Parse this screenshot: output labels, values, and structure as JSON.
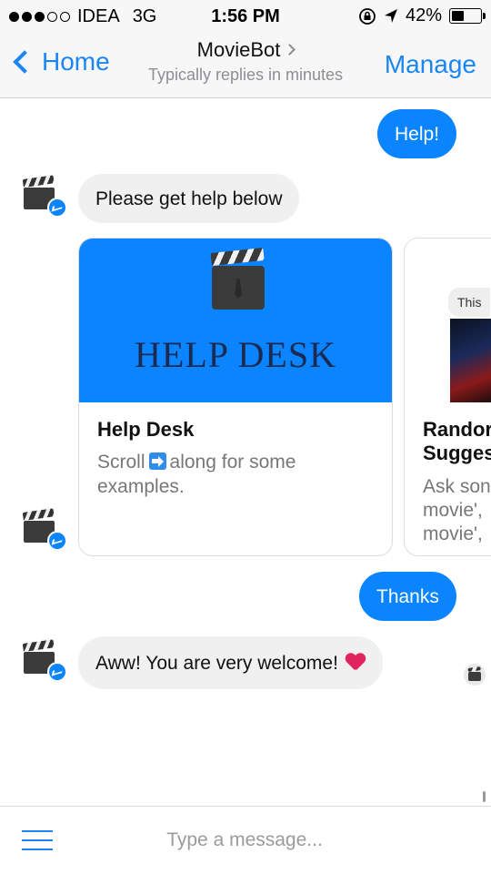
{
  "status_bar": {
    "carrier": "IDEA",
    "network": "3G",
    "time": "1:56 PM",
    "battery": "42%",
    "battery_level": 0.42
  },
  "nav": {
    "back_label": "Home",
    "title": "MovieBot",
    "subtitle": "Typically replies in minutes",
    "manage_label": "Manage"
  },
  "messages": {
    "user_help": "Help!",
    "bot_help_intro": "Please get help below",
    "user_thanks": "Thanks",
    "bot_welcome": "Aww! You are very welcome!"
  },
  "carousel": [
    {
      "image_caption": "HELP DESK",
      "title": "Help Desk",
      "subtitle_before": "Scroll",
      "subtitle_after": "along for some examples."
    },
    {
      "image_bubble": "This",
      "title_line1": "Randor",
      "title_line2": "Sugges",
      "sub_line1": "Ask son",
      "sub_line2": "movie',",
      "sub_line3": "movie',"
    }
  ],
  "composer": {
    "placeholder": "Type a message..."
  },
  "colors": {
    "accent": "#1a86f4",
    "outgoing_bubble": "#0a84ff",
    "incoming_bubble": "#f0f0f0",
    "card_image_bg": "#0a84ff"
  }
}
